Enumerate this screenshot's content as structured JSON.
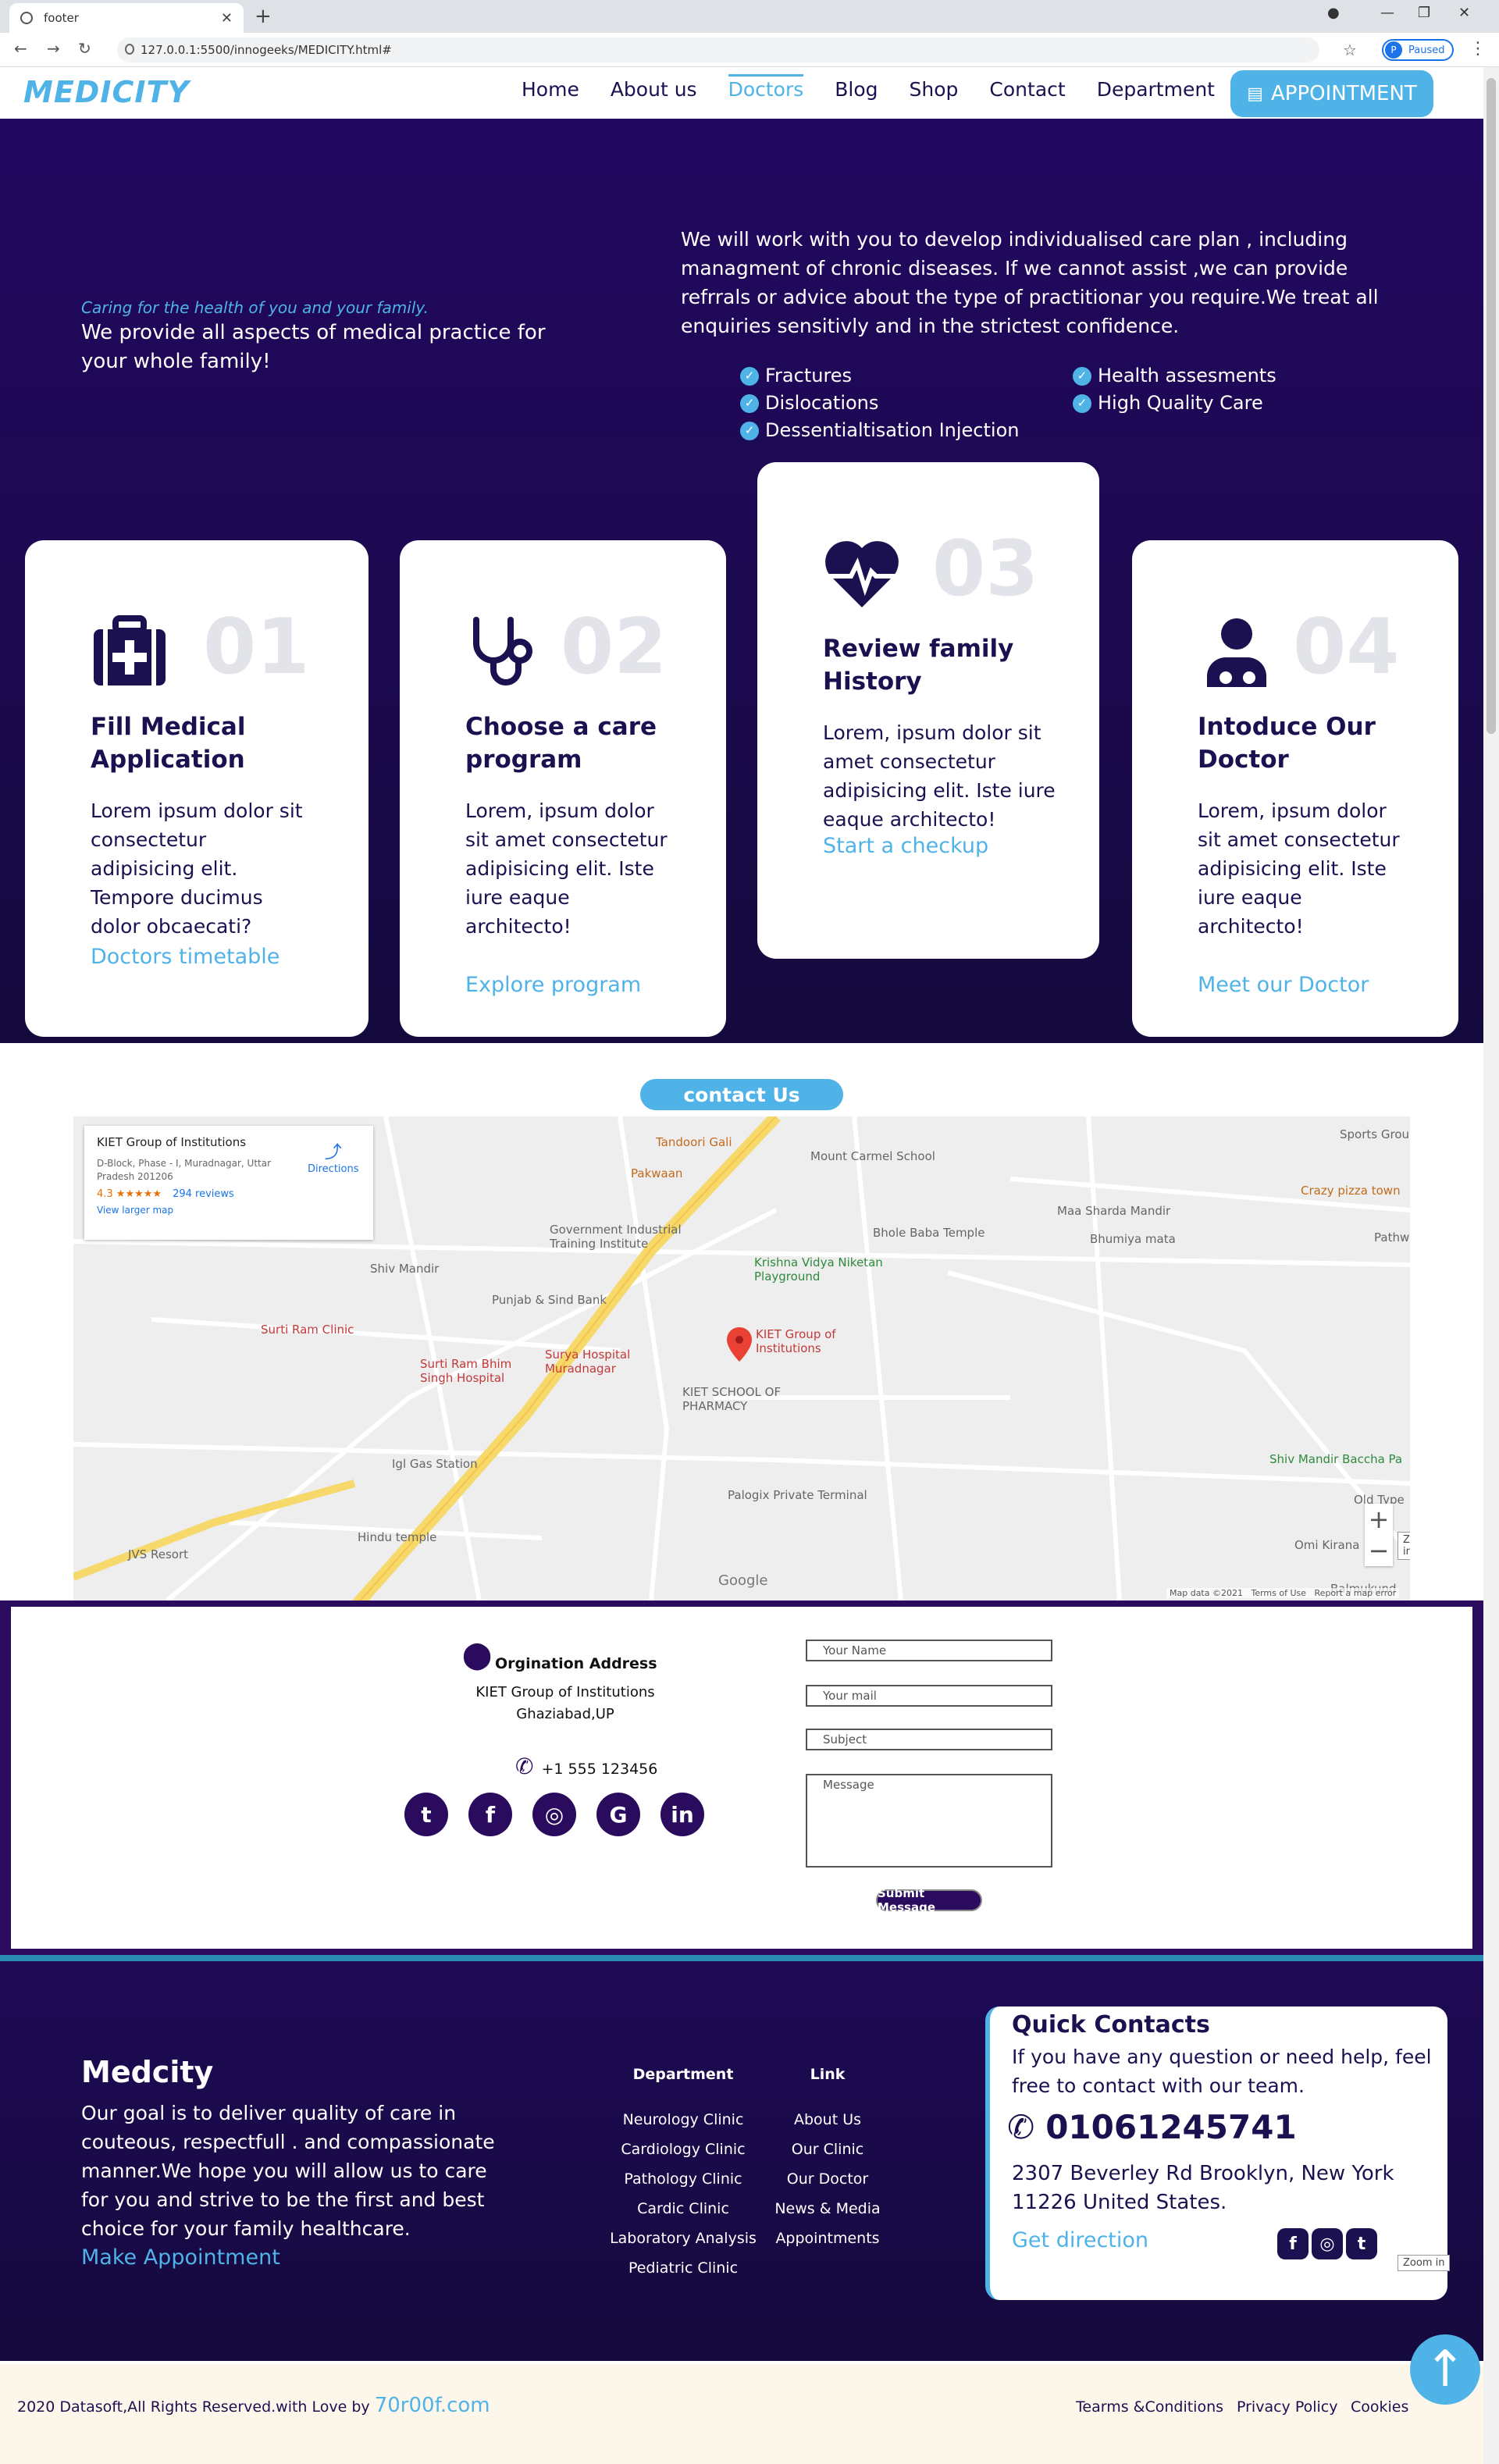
{
  "browser": {
    "tab_title": "footer",
    "url": "127.0.0.1:5500/innogeeks/MEDICITY.html#",
    "profile_status": "Paused",
    "profile_initial": "P"
  },
  "nav": {
    "logo": "MEDICITY",
    "items": [
      "Home",
      "About us",
      "Doctors",
      "Blog",
      "Shop",
      "Contact",
      "Department"
    ],
    "active": "Doctors",
    "appointment": "APPOINTMENT"
  },
  "hero": {
    "tagline": "Caring for the health of you and your family.",
    "heading": "We provide all aspects of medical practice for your whole family!",
    "paragraph": "We will work with you to develop individualised care plan , including managment of chronic diseases. If we cannot assist ,we can provide refrrals or advice about the type of practitionar you require.We treat all enquiries sensitivly and in the strictest confidence.",
    "checks_left": [
      "Fractures",
      "Dislocations",
      "Dessentialtisation Injection"
    ],
    "checks_right": [
      "Health assesments",
      "High Quality Care"
    ]
  },
  "cards": [
    {
      "num": "01",
      "icon": "first-aid-kit-icon",
      "title": "Fill Medical Application",
      "desc": "Lorem ipsum dolor sit consectetur adipisicing elit. Tempore ducimus dolor obcaecati?",
      "link": "Doctors timetable"
    },
    {
      "num": "02",
      "icon": "stethoscope-icon",
      "title": "Choose a care program",
      "desc": "Lorem, ipsum dolor sit amet consectetur adipisicing elit. Iste iure eaque architecto!",
      "link": "Explore program"
    },
    {
      "num": "03",
      "icon": "heartbeat-icon",
      "title": "Review family History",
      "desc": "Lorem, ipsum dolor sit amet consectetur adipisicing elit. Iste iure eaque architecto!",
      "link": "Start a checkup"
    },
    {
      "num": "04",
      "icon": "doctor-icon",
      "title": "Intoduce Our Doctor",
      "desc": "Lorem, ipsum dolor sit amet consectetur adipisicing elit. Iste iure eaque architecto!",
      "link": "Meet our Doctor"
    }
  ],
  "contact": {
    "pill": "contact Us",
    "map": {
      "place_title": "KIET Group of Institutions",
      "place_address": "D-Block, Phase - I, Muradnagar, Uttar Pradesh 201206",
      "rating": "4.3 ★★★★★",
      "reviews": "294 reviews",
      "larger_map": "View larger map",
      "directions": "Directions",
      "labels": [
        "Tandoori Gali",
        "Pakwaan",
        "Mount Carmel School",
        "Sports Ground Ordnance Fac",
        "Crazy pizza town",
        "Government Industrial Training Institute",
        "Bhole Baba Temple",
        "Maa Sharda Mandir",
        "Bhumiya mata",
        "Pathw",
        "Shiv Mandir",
        "Punjab & Sind Bank",
        "Krishna Vidya Niketan Playground",
        "Surti Ram Clinic",
        "Surti Ram Bhim Singh Hospital",
        "Surya Hospital Muradnagar",
        "KIET Group of Institutions",
        "KIET SCHOOL OF PHARMACY",
        "Igl Gas Station",
        "Shiv Mandir Baccha Pa",
        "Palogix Private Terminal",
        "Hindu temple",
        "JVS Resort",
        "Omi Kirana",
        "Old Type",
        "Balmukund"
      ],
      "zoom_tip": "Zoom in",
      "google": "Google",
      "map_data": "Map data ©2021",
      "terms": "Terms of Use",
      "report": "Report a map error"
    }
  },
  "form": {
    "org_title": "Orgination Address",
    "org_line1": "KIET Group of Institutions",
    "org_line2": "Ghaziabad,UP",
    "phone": "+1 555 123456",
    "name_ph": "Your Name",
    "mail_ph": "Your mail",
    "subject_ph": "Subject",
    "message_ph": "Message",
    "submit": "Submit Message"
  },
  "footer": {
    "brand": "Medcity",
    "about": "Our goal is to deliver quality of care in couteous, respectfull . and compassionate manner.We hope you will allow us to care for you and strive to be the first and best choice for your family healthcare.",
    "make": "Make Appointment",
    "department_heading": "Department",
    "departments": [
      "Neurology Clinic",
      "Cardiology Clinic",
      "Pathology Clinic",
      "Cardic Clinic",
      "Laboratory Analysis",
      "Pediatric Clinic"
    ],
    "link_heading": "Link",
    "links": [
      "About Us",
      "Our Clinic",
      "Our Doctor",
      "News & Media",
      "Appointments"
    ],
    "qc_title": "Quick Contacts",
    "qc_desc": "If you have any question or need help, feel free to contact with our team.",
    "qc_phone": "01061245741",
    "qc_address": "2307 Beverley Rd Brooklyn, New York 11226 United States.",
    "qc_direction": "Get direction",
    "zoom_tip": "Zoom in"
  },
  "bottom": {
    "copyright": "2020 Datasoft,All Rights Reserved.with Love by ",
    "brand": "70r00f.com",
    "terms": "Tearms &Conditions",
    "privacy": "Privacy Policy",
    "cookies": "Cookies"
  },
  "colors": {
    "accent": "#4fb3e8",
    "navy": "#1c1150",
    "hero_bg": "#22075f"
  }
}
